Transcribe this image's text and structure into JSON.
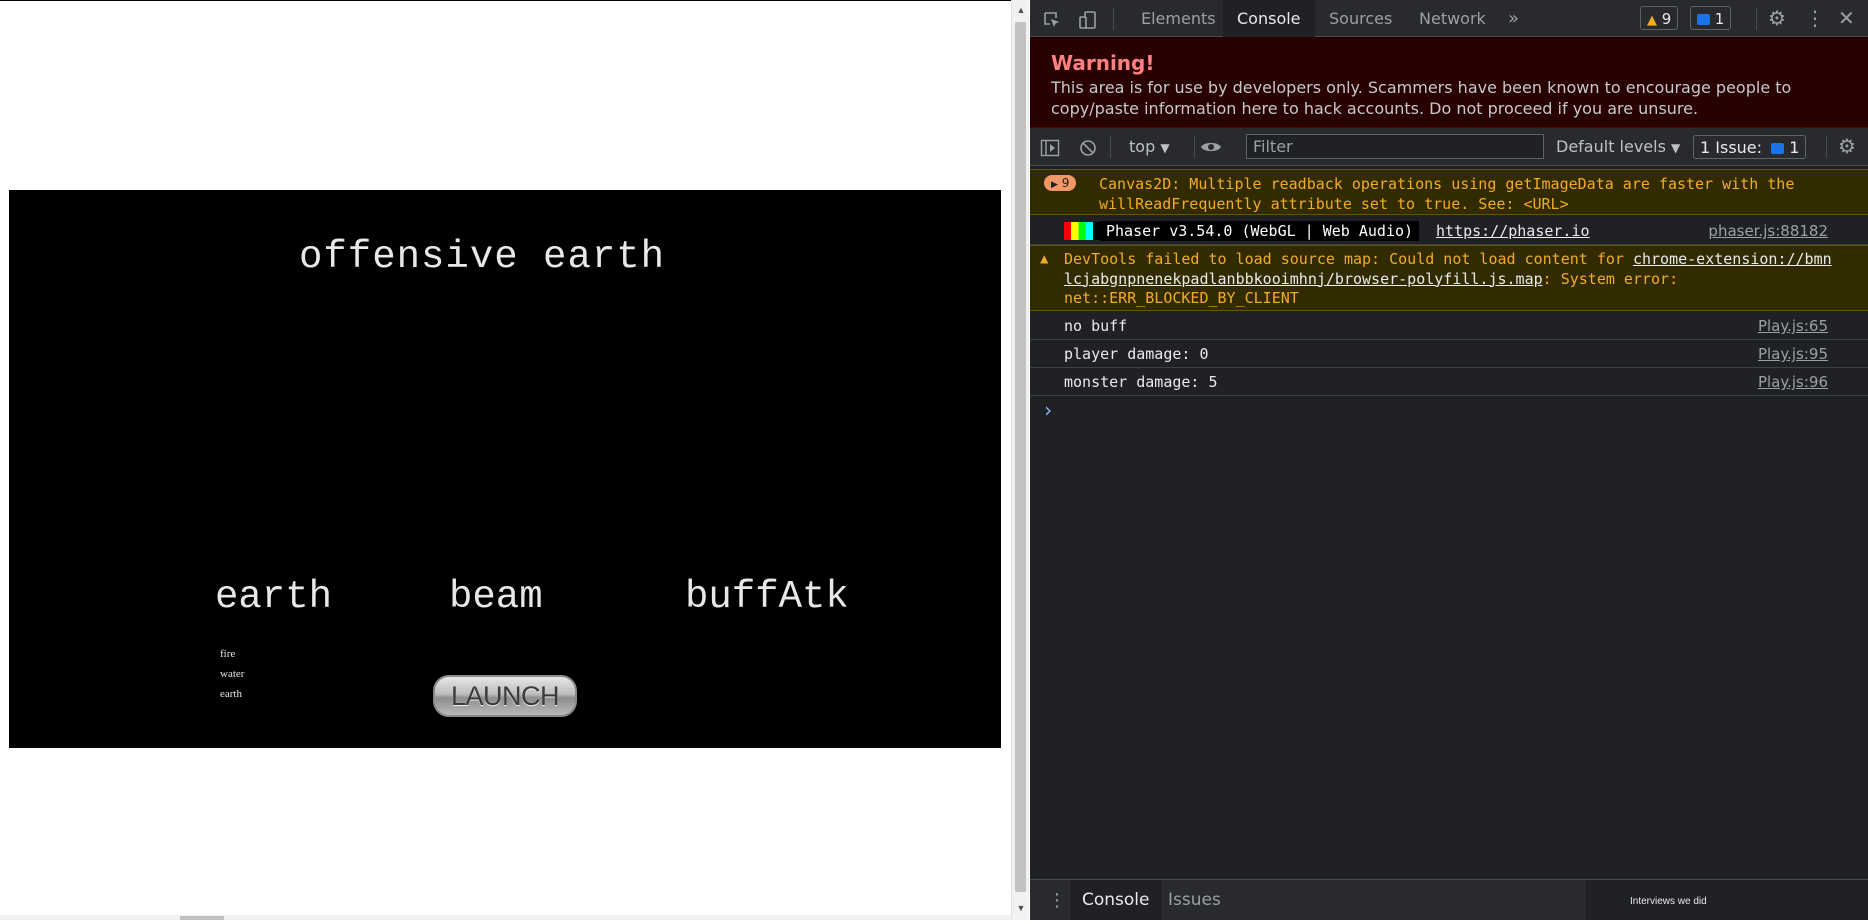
{
  "game": {
    "title": "offensive earth",
    "options": [
      "earth",
      "beam",
      "buffAtk"
    ],
    "elements": [
      "fire",
      "water",
      "earth"
    ],
    "launch_label": "LAUNCH"
  },
  "devtools": {
    "tabs": [
      "Elements",
      "Console",
      "Sources",
      "Network"
    ],
    "more_tabs": "»",
    "warning_count": "9",
    "message_count": "1",
    "banner": {
      "title": "Warning!",
      "text": "This area is for use by developers only. Scammers have been known to encourage people to copy/paste information here to hack accounts. Do not proceed if you are unsure."
    },
    "filterbar": {
      "context": "top",
      "filter_placeholder": "Filter",
      "levels": "Default levels",
      "issues_label": "1 Issue:",
      "issues_count": "1"
    },
    "console": {
      "canvas_warning": {
        "count": "9",
        "text": "Canvas2D: Multiple readback operations using getImageData are faster with the willReadFrequently attribute set to true. See: <URL>"
      },
      "phaser": {
        "text": "Phaser v3.54.0 (WebGL | Web Audio)",
        "link": "https://phaser.io",
        "source": "phaser.js:88182"
      },
      "sourcemap_warning": {
        "prefix": "DevTools failed to load source map: Could not load content for ",
        "link1": "chrome-extension://bmn",
        "link2": "lcjabgnpnenekpadlanbbkooimhnj/browser-polyfill.js.map",
        "suffix": ": System error:",
        "error": "net::ERR_BLOCKED_BY_CLIENT"
      },
      "logs": [
        {
          "text": "no buff",
          "source": "Play.js:65"
        },
        {
          "text": "player damage: 0",
          "source": "Play.js:95"
        },
        {
          "text": "monster damage: 5",
          "source": "Play.js:96"
        }
      ],
      "prompt": "›"
    },
    "drawer": {
      "tabs": [
        "Console",
        "Issues"
      ],
      "popup_text": "Interviews we did"
    }
  }
}
